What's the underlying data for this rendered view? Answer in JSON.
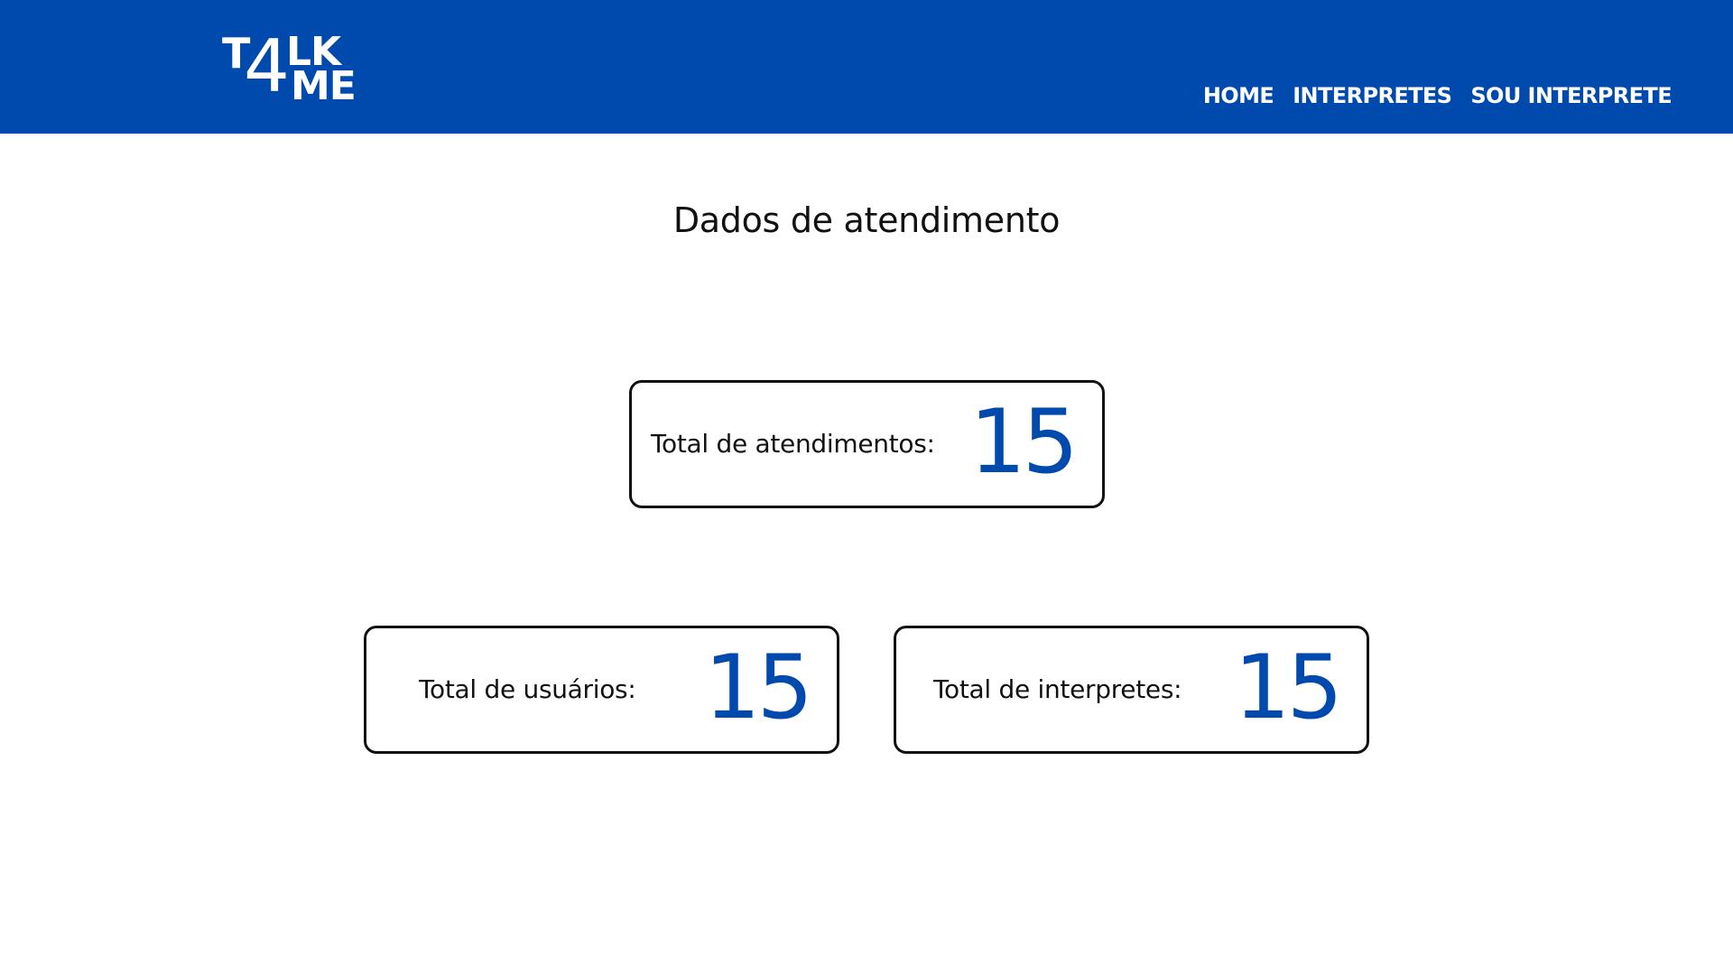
{
  "header": {
    "logo": {
      "text": "T4LK ME",
      "parts": [
        "T",
        "4",
        "LK",
        "ME"
      ]
    },
    "nav": [
      {
        "label": "HOME"
      },
      {
        "label": "INTERPRETES"
      },
      {
        "label": "SOU INTERPRETE"
      }
    ]
  },
  "main": {
    "title": "Dados de atendimento",
    "stats": {
      "atendimentos": {
        "label": "Total de atendimentos:",
        "value": "15"
      },
      "usuarios": {
        "label": "Total de usuários:",
        "value": "15"
      },
      "interpretes": {
        "label": "Total de interpretes:",
        "value": "15"
      }
    }
  },
  "colors": {
    "brand": "#004aad",
    "background": "#ffffff",
    "text": "#111111"
  }
}
